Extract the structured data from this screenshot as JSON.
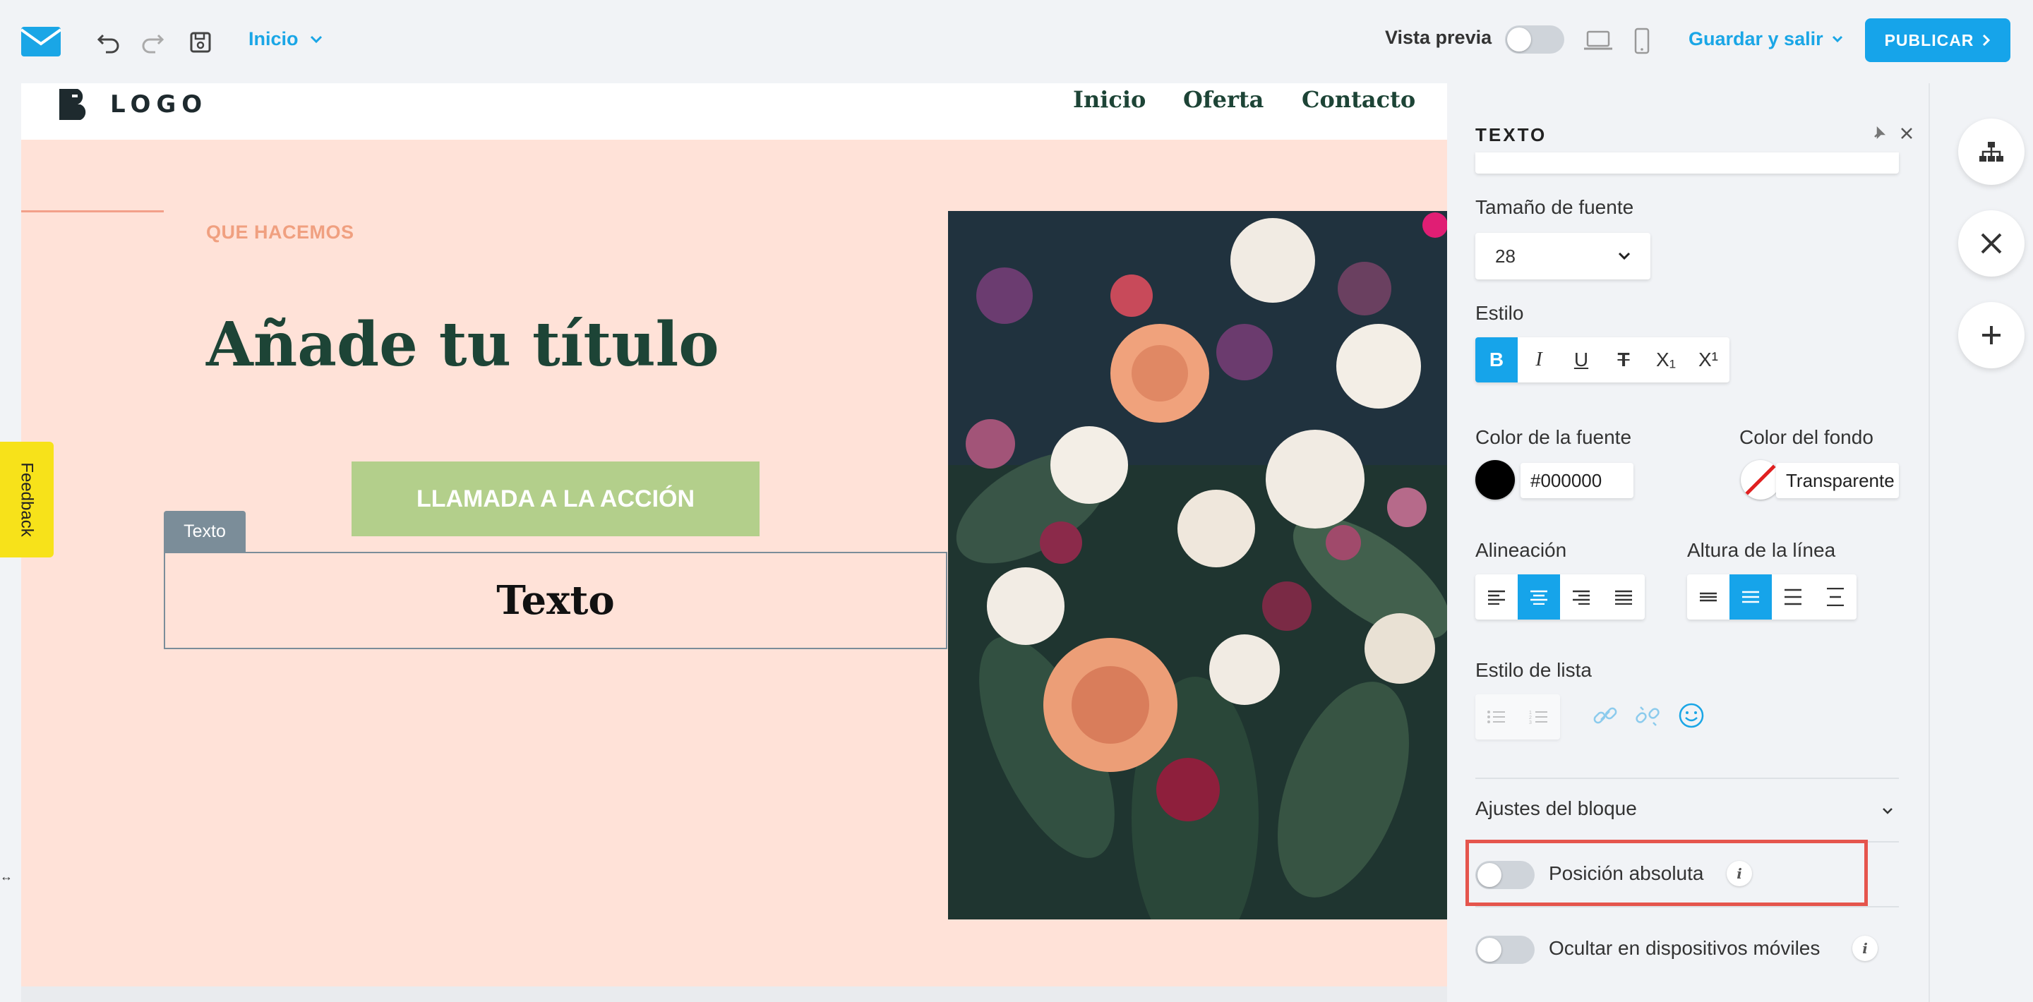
{
  "topbar": {
    "page_select": "Inicio",
    "preview_label": "Vista previa",
    "save_exit": "Guardar y salir",
    "publish": "PUBLICAR"
  },
  "site": {
    "logo_text": "LOGO",
    "nav": [
      "Inicio",
      "Oferta",
      "Contacto"
    ],
    "kicker": "QUE HACEMOS",
    "title": "Añade tu título",
    "cta": "LLAMADA A LA ACCIÓN",
    "text_tag": "Texto",
    "text_block": "Texto"
  },
  "feedback": "Feedback",
  "panel": {
    "title": "TEXTO",
    "font_size_label": "Tamaño de fuente",
    "font_size_value": "28",
    "style_label": "Estilo",
    "style_buttons": [
      "B",
      "I",
      "U",
      "T",
      "X₁",
      "X¹"
    ],
    "font_color_label": "Color de la fuente",
    "font_color_value": "#000000",
    "bg_color_label": "Color del fondo",
    "bg_color_value": "Transparente",
    "align_label": "Alineación",
    "line_height_label": "Altura de la línea",
    "list_style_label": "Estilo de lista",
    "block_settings": "Ajustes del bloque",
    "absolute_position": "Posición absoluta",
    "hide_mobile": "Ocultar en dispositivos móviles"
  },
  "colors": {
    "accent": "#16a4ea",
    "canvas_bg": "#ffe2d8",
    "title_green": "#1d4436",
    "cta_green": "#b3cf8b",
    "highlight": "#e5554d"
  }
}
